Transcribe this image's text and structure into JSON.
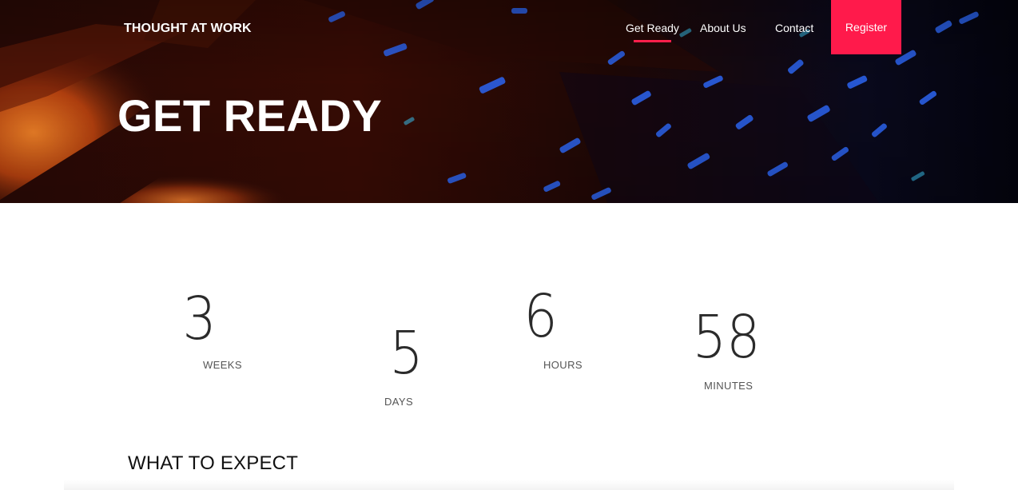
{
  "brand": "THOUGHT AT WORK",
  "nav": {
    "items": [
      {
        "label": "Get Ready",
        "active": true
      },
      {
        "label": "About Us",
        "active": false
      },
      {
        "label": "Contact",
        "active": false
      }
    ],
    "register_label": "Register"
  },
  "hero": {
    "title": "GET READY"
  },
  "countdown": {
    "weeks": {
      "value": "3",
      "label": "WEEKS"
    },
    "days": {
      "value": "5",
      "label": "DAYS"
    },
    "hours": {
      "value": "6",
      "label": "HOURS"
    },
    "minutes": {
      "value": "58",
      "label": "MINUTES"
    }
  },
  "sections": {
    "expect_title": "WHAT TO EXPECT"
  },
  "colors": {
    "accent": "#ff1a4b",
    "text_dark": "#2b2b2b",
    "hero_orange": "#e0641e",
    "hero_blue": "#2a6cff"
  }
}
